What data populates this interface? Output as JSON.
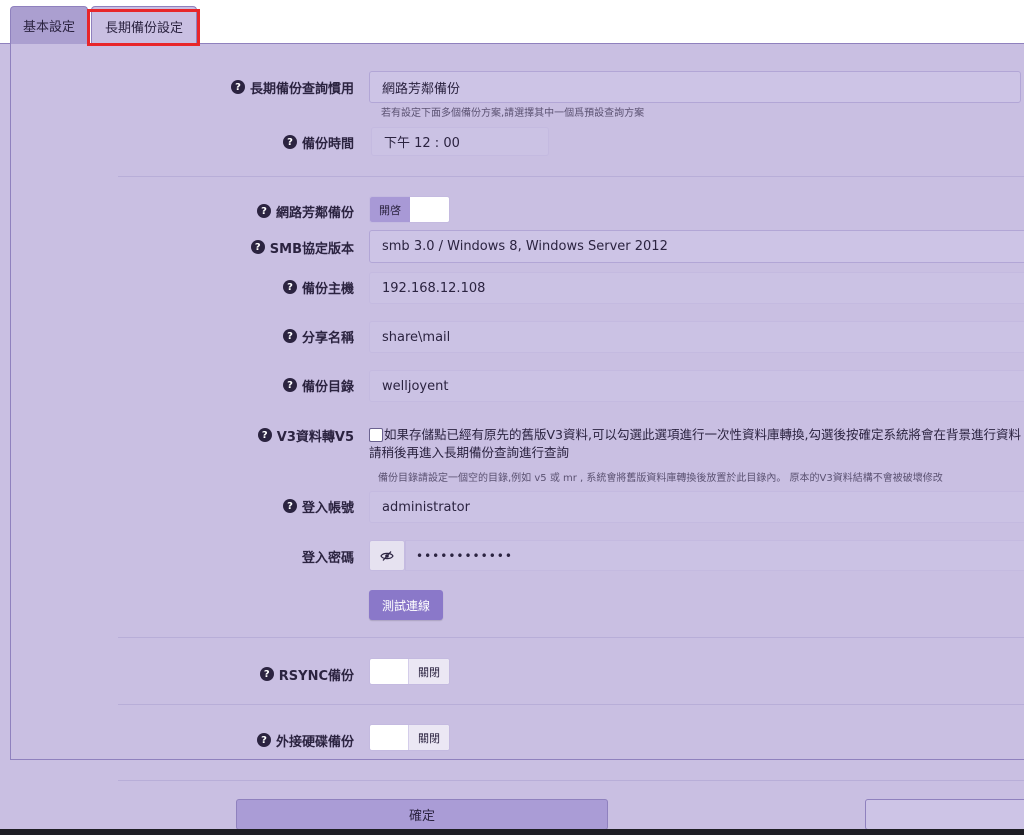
{
  "tabs": {
    "basic": "基本設定",
    "long_term": "長期備份設定"
  },
  "form": {
    "query_preference": {
      "label": "長期備份查詢慣用",
      "value": "網路芳鄰備份",
      "hint": "若有設定下面多個備份方案,請選擇其中一個爲預設查詢方案"
    },
    "backup_time": {
      "label": "備份時間",
      "value": "下午 12 : 00"
    },
    "network_backup": {
      "label": "網路芳鄰備份",
      "toggle": "開啓"
    },
    "smb_version": {
      "label": "SMB協定版本",
      "value": "smb 3.0 / Windows 8, Windows Server 2012"
    },
    "backup_host": {
      "label": "備份主機",
      "value": "192.168.12.108"
    },
    "share_name": {
      "label": "分享名稱",
      "value": "share\\mail"
    },
    "backup_dir": {
      "label": "備份目錄",
      "value": "welljoyent"
    },
    "v3_convert": {
      "label": "V3資料轉V5",
      "text_line1": "如果存儲點已經有原先的舊版V3資料,可以勾選此選項進行一次性資料庫轉換,勾選後按確定系統將會在背景進行資料",
      "text_line2": "請稍後再進入長期備份查詢進行查詢",
      "hint": "備份目錄請設定一個空的目錄,例如 v5 或 mr , 系統會將舊版資料庫轉換後放置於此目錄內。 原本的V3資料結構不會被破壞修改",
      "checked": false
    },
    "login_account": {
      "label": "登入帳號",
      "value": "administrator"
    },
    "login_password": {
      "label": "登入密碼",
      "value": "••••••••••••"
    },
    "test_button": "測試連線",
    "rsync_backup": {
      "label": "RSYNC備份",
      "toggle": "關閉"
    },
    "external_disk_backup": {
      "label": "外接硬碟備份",
      "toggle": "關閉"
    }
  },
  "buttons": {
    "ok": "確定"
  },
  "icons": {
    "help": "help-circle-icon",
    "eye": "eye-slash-icon"
  },
  "colors": {
    "accent": "#8a78c9",
    "highlight_box": "#e8262a",
    "background": "#c9bfe2"
  }
}
